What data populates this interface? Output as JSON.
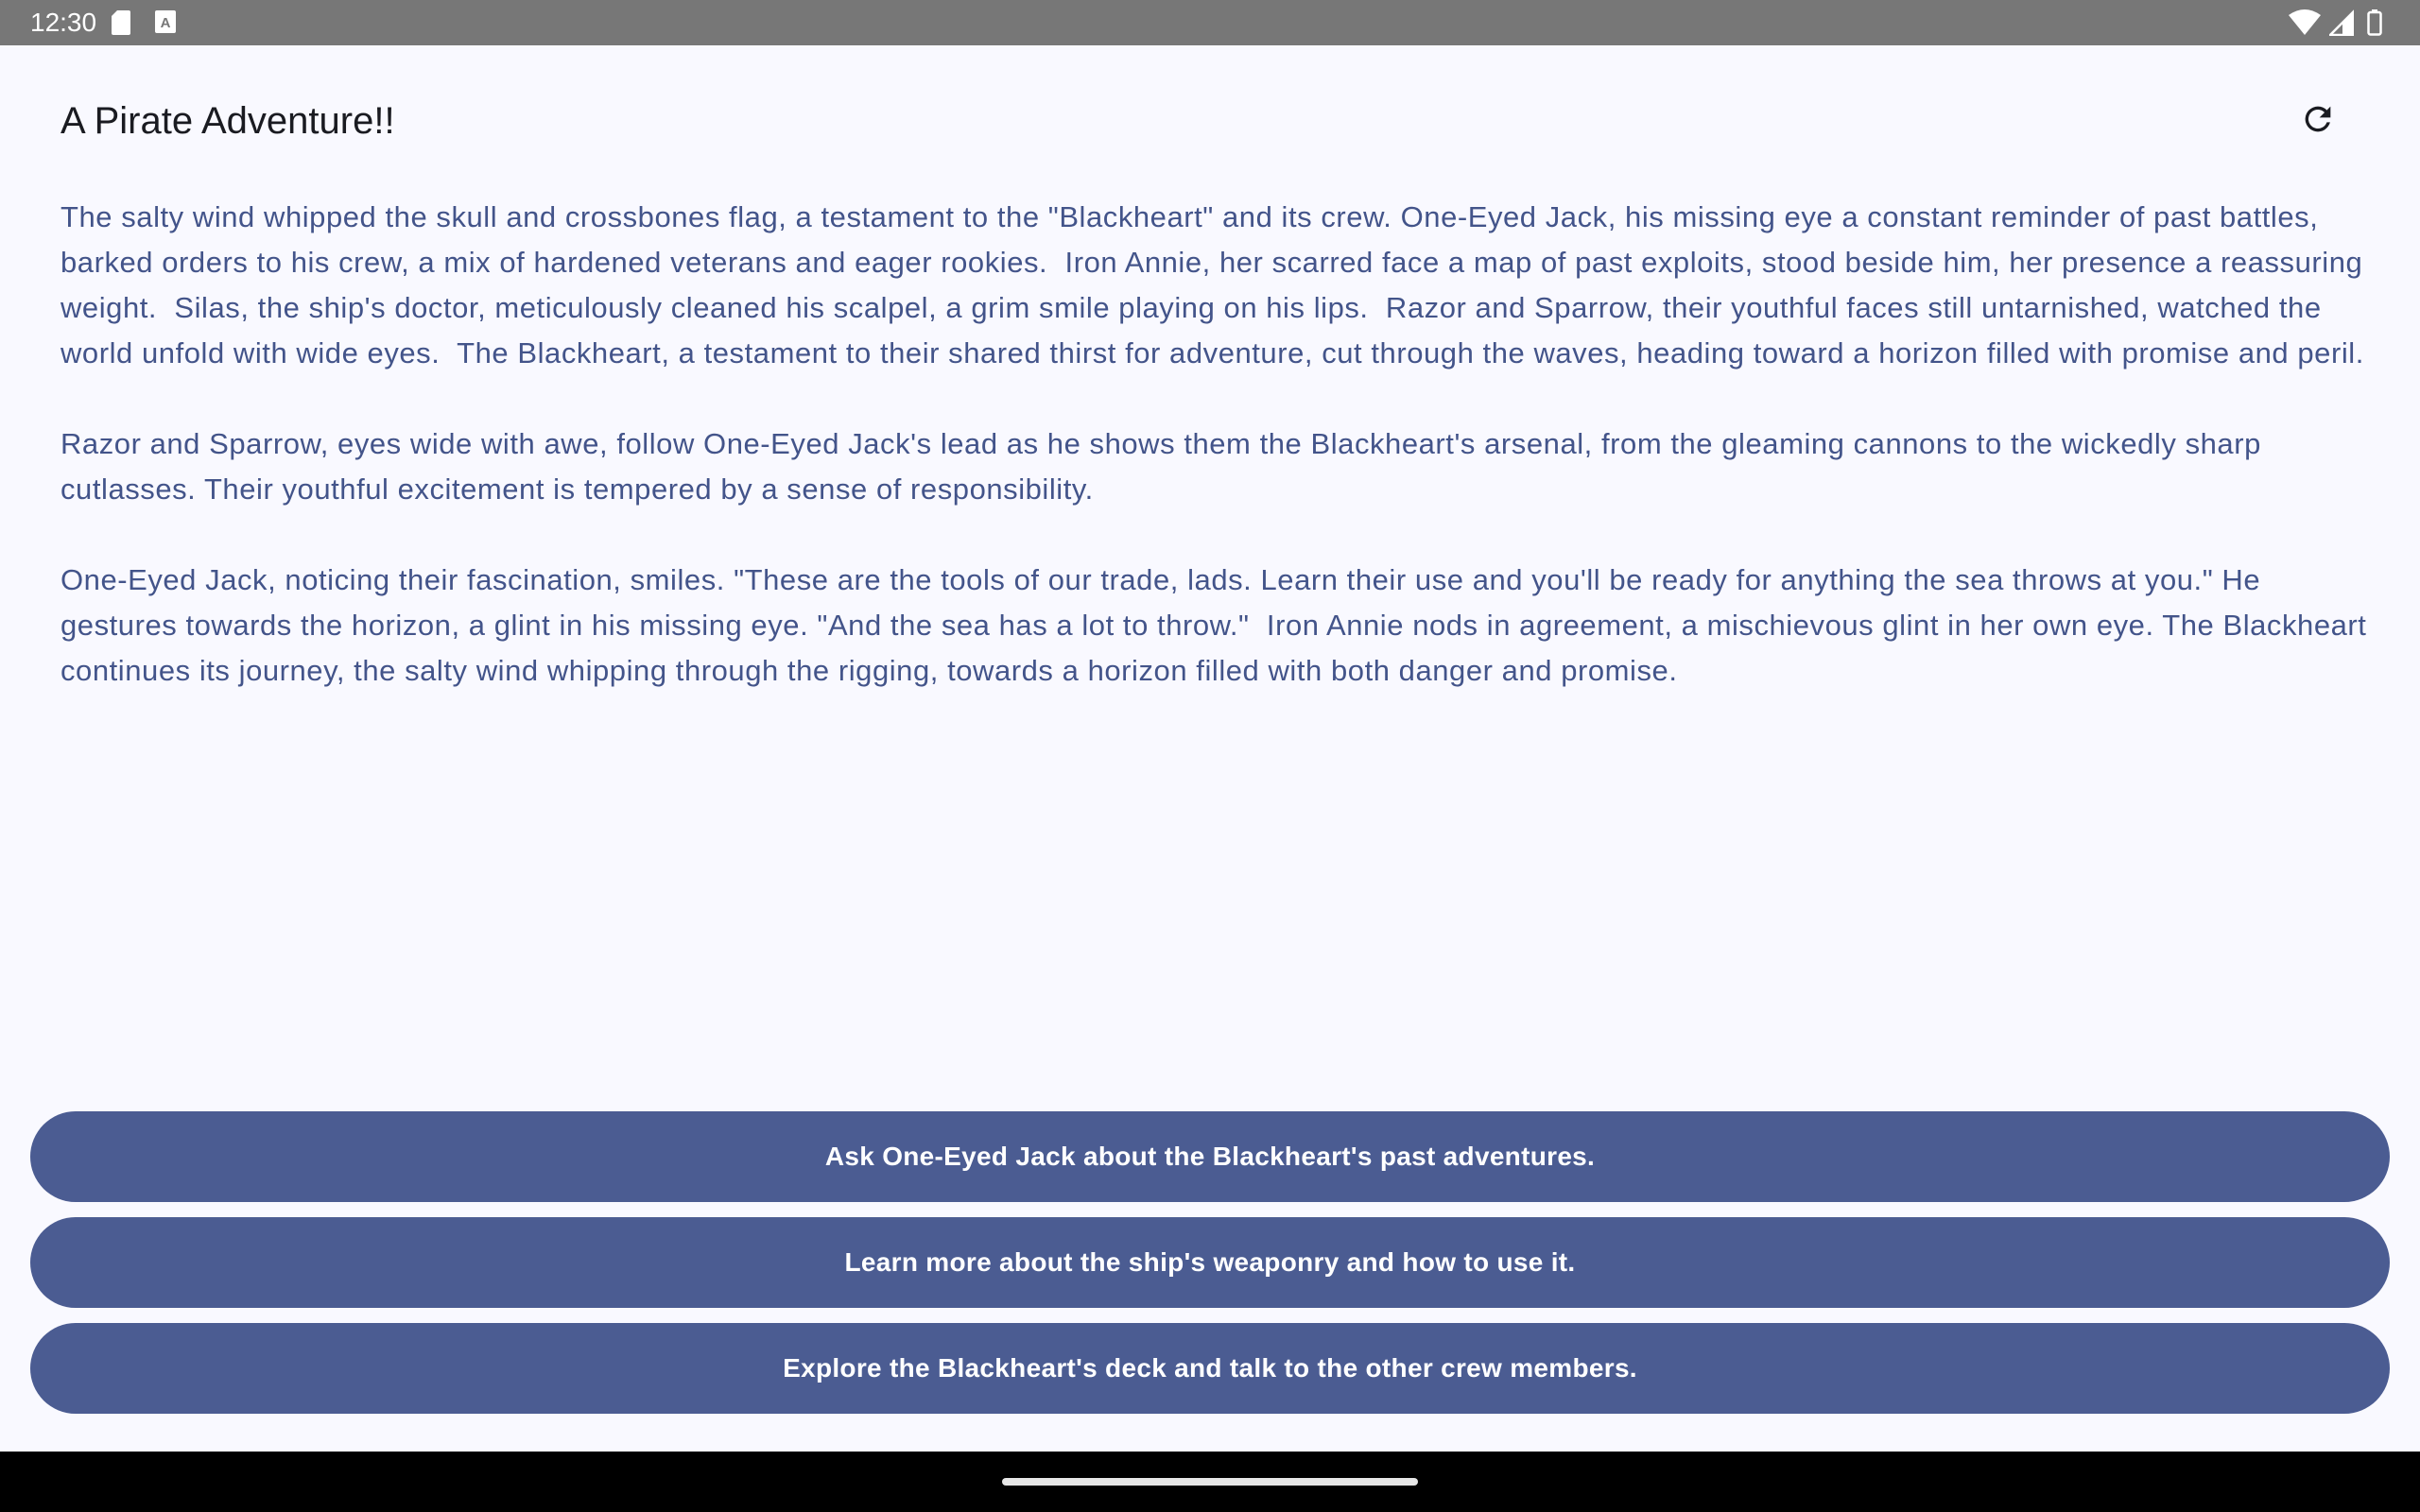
{
  "status_bar": {
    "time": "12:30",
    "left_icons": [
      "sd-card-icon",
      "keyboard-a-icon"
    ],
    "right_icons": [
      "wifi-icon",
      "cell-signal-icon",
      "battery-icon"
    ]
  },
  "app_bar": {
    "title": "A Pirate Adventure!!",
    "action_icon": "refresh-icon"
  },
  "story": {
    "paragraphs": [
      "The salty wind whipped the skull and crossbones flag, a testament to the \"Blackheart\" and its crew. One-Eyed Jack, his missing eye a constant reminder of past battles, barked orders to his crew, a mix of hardened veterans and eager rookies.  Iron Annie, her scarred face a map of past exploits, stood beside him, her presence a reassuring weight.  Silas, the ship's doctor, meticulously cleaned his scalpel, a grim smile playing on his lips.  Razor and Sparrow, their youthful faces still untarnished, watched the world unfold with wide eyes.  The Blackheart, a testament to their shared thirst for adventure, cut through the waves, heading toward a horizon filled with promise and peril.",
      "Razor and Sparrow, eyes wide with awe, follow One-Eyed Jack's lead as he shows them the Blackheart's arsenal, from the gleaming cannons to the wickedly sharp cutlasses. Their youthful excitement is tempered by a sense of responsibility.",
      "One-Eyed Jack, noticing their fascination, smiles. \"These are the tools of our trade, lads. Learn their use and you'll be ready for anything the sea throws at you.\" He gestures towards the horizon, a glint in his missing eye. \"And the sea has a lot to throw.\"  Iron Annie nods in agreement, a mischievous glint in her own eye. The Blackheart continues its journey, the salty wind whipping through the rigging, towards a horizon filled with both danger and promise."
    ]
  },
  "choices": [
    {
      "label": "Ask One-Eyed Jack about the Blackheart's past adventures."
    },
    {
      "label": "Learn more about the ship's weaponry and how to use it."
    },
    {
      "label": "Explore the Blackheart's deck and talk to the other crew members."
    }
  ],
  "colors": {
    "background": "#f9f9ff",
    "story_text": "#43548a",
    "button": "#4b5c92",
    "status_bar": "#777777"
  }
}
